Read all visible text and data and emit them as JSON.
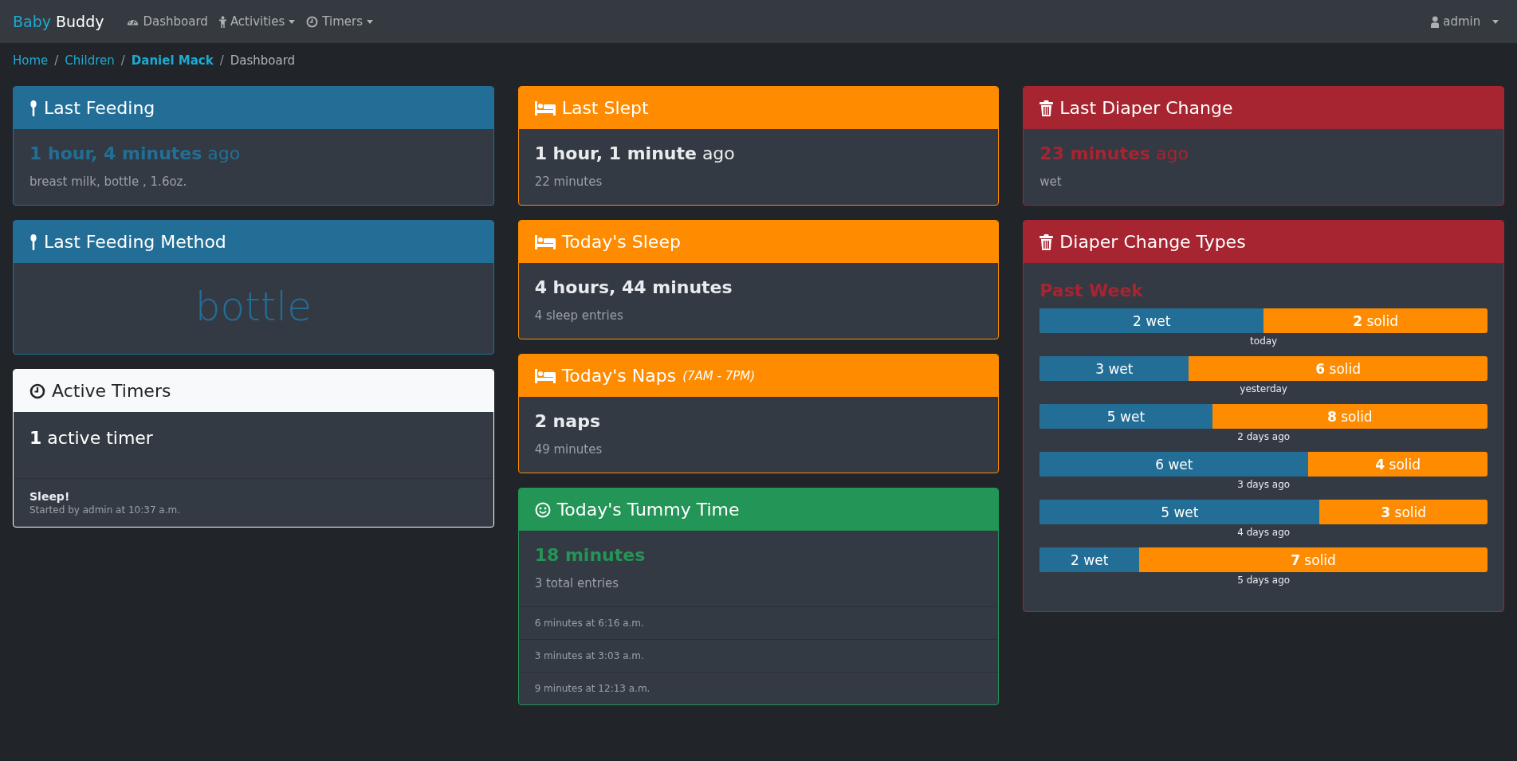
{
  "navbar": {
    "brand_first": "Baby",
    "brand_second": "Buddy",
    "nav_items": [
      {
        "kind": "dashboard",
        "label": "Dashboard",
        "dropdown": false
      },
      {
        "kind": "activities",
        "label": "Activities",
        "dropdown": true
      },
      {
        "kind": "timers",
        "label": "Timers",
        "dropdown": true
      }
    ],
    "user": {
      "label": "admin",
      "dropdown": true
    }
  },
  "breadcrumb": [
    {
      "label": "Home",
      "kind": "link"
    },
    {
      "label": "/",
      "kind": "separator"
    },
    {
      "label": "Children",
      "kind": "link"
    },
    {
      "label": "/",
      "kind": "separator"
    },
    {
      "label": "Daniel Mack",
      "kind": "strong"
    },
    {
      "label": "/",
      "kind": "separator"
    },
    {
      "label": "Dashboard",
      "kind": "current"
    }
  ],
  "columns": [
    [
      {
        "kind": "feeding",
        "title": "Last Feeding",
        "headline": "**1 hour, 4 minutes** ago",
        "accent": true,
        "emphasis": false,
        "subtext": "breast milk, bottle , 1.6oz."
      },
      {
        "kind": "method",
        "title": "Last Feeding Method",
        "value": "bottle"
      },
      {
        "kind": "timers",
        "title": "Active Timers",
        "headline": "**1** active timer",
        "timers": [
          {
            "name": "Sleep!",
            "detail": "Started by admin at 10:37 a.m."
          }
        ]
      }
    ],
    [
      {
        "kind": "sleep",
        "title": "Last Slept",
        "headline": "**1 hour, 1 minute** ago",
        "accent": false,
        "emphasis": false,
        "subtext": "22 minutes"
      },
      {
        "kind": "sleep",
        "title": "Today's Sleep",
        "headline": "4 hours, 44 minutes",
        "accent": false,
        "emphasis": true,
        "subtext": "4 sleep entries"
      },
      {
        "kind": "sleep",
        "title": "Today's Naps",
        "title_note": "(7AM - 7PM)",
        "headline": "2 naps",
        "accent": false,
        "emphasis": true,
        "subtext": "49 minutes"
      },
      {
        "kind": "tummy",
        "title": "Today's Tummy Time",
        "headline": "18 minutes",
        "accent": true,
        "emphasis": true,
        "subtext": "3 total entries",
        "entries": [
          "6 minutes at 6:16 a.m.",
          "3 minutes at 3:03 a.m.",
          "9 minutes at 12:13 a.m."
        ]
      }
    ],
    [
      {
        "kind": "diaper",
        "title": "Last Diaper Change",
        "headline": "**23 minutes** ago",
        "accent": true,
        "emphasis": false,
        "subtext": "wet"
      },
      {
        "kind": "diapertypes",
        "title": "Diaper Change Types",
        "heading": "Past Week",
        "rows": [
          {
            "wet": "2 wet",
            "solid": "**2** solid",
            "level": 0.5,
            "day": "today"
          },
          {
            "wet": "3 wet",
            "solid": "**6** solid",
            "level": 0.333,
            "day": "yesterday"
          },
          {
            "wet": "5 wet",
            "solid": "**8** solid",
            "level": 0.385,
            "day": "2 days ago"
          },
          {
            "wet": "6 wet",
            "solid": "**4** solid",
            "level": 0.6,
            "day": "3 days ago"
          },
          {
            "wet": "5 wet",
            "solid": "**3** solid",
            "level": 0.625,
            "day": "4 days ago"
          },
          {
            "wet": "2 wet",
            "solid": "**7** solid",
            "level": 0.222,
            "day": "5 days ago"
          }
        ]
      }
    ]
  ]
}
